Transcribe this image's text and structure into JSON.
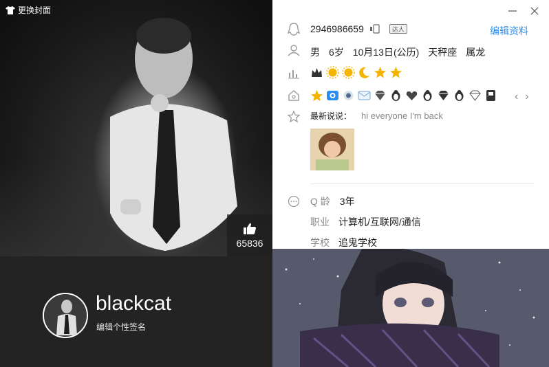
{
  "cover": {
    "change_cover_label": "更换封面",
    "like_count": "65836"
  },
  "profile": {
    "nickname": "blackcat",
    "signature": "编辑个性签名"
  },
  "info": {
    "qq_number": "2946986659",
    "badge_label": "达人",
    "edit_label": "编辑资料",
    "basic": [
      "男",
      "6岁",
      "10月13日(公历)",
      "天秤座",
      "属龙"
    ],
    "status_label": "最新说说：",
    "status_text": "hi everyone I'm back",
    "qage_label": "Q 龄",
    "qage_value": "3年",
    "job_label": "职业",
    "job_value": "计算机/互联网/通信",
    "school_label": "学校",
    "school_value": "追鬼学校",
    "level_icons": [
      "crown-icon",
      "sun-icon",
      "sun-icon",
      "moon-icon",
      "star-icon",
      "star-icon"
    ],
    "service_icons": [
      "star-icon",
      "camera-icon",
      "pet-icon",
      "mail-icon",
      "diamond-icon",
      "penguin-icon",
      "heart-diamond-icon",
      "penguin-icon",
      "diamond-icon",
      "penguin-icon",
      "diamond-icon",
      "game-icon"
    ]
  },
  "colors": {
    "accent": "#2a8ff0",
    "gold": "#f4b400",
    "dark_bar": "#232323"
  }
}
